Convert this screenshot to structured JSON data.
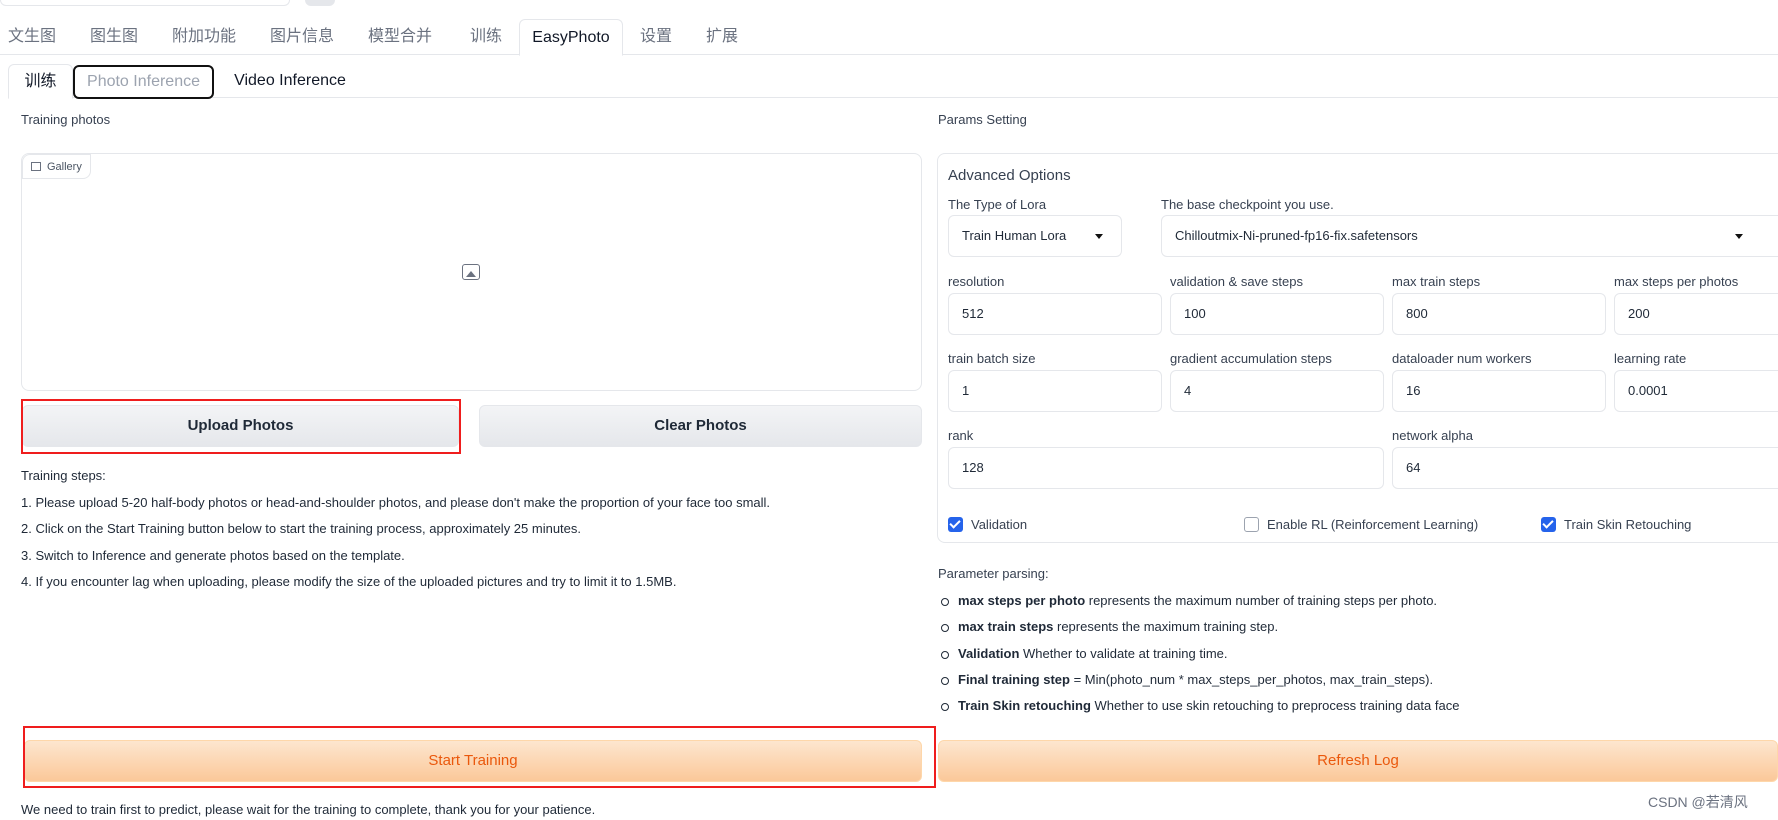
{
  "main_tabs": [
    "文生图",
    "图生图",
    "附加功能",
    "图片信息",
    "模型合并",
    "训练",
    "EasyPhoto",
    "设置",
    "扩展"
  ],
  "sub_tabs": [
    "训练",
    "Photo Inference",
    "Video Inference"
  ],
  "left": {
    "section_label": "Training photos",
    "gallery_label": "Gallery",
    "upload_button": "Upload Photos",
    "clear_button": "Clear Photos",
    "steps_title": "Training steps:",
    "steps": [
      "1. Please upload 5-20 half-body photos or head-and-shoulder photos, and please don't make the proportion of your face too small.",
      "2. Click on the Start Training button below to start the training process, approximately 25 minutes.",
      "3. Switch to Inference and generate photos based on the template.",
      "4. If you encounter lag when uploading, please modify the size of the uploaded pictures and try to limit it to 1.5MB."
    ],
    "start_button": "Start Training",
    "footer_note": "We need to train first to predict, please wait for the training to complete, thank you for your patience."
  },
  "right": {
    "section_label": "Params Setting",
    "advanced_title": "Advanced Options",
    "lora_type_label": "The Type of Lora",
    "lora_type_value": "Train Human Lora",
    "checkpoint_label": "The base checkpoint you use.",
    "checkpoint_value": "Chilloutmix-Ni-pruned-fp16-fix.safetensors",
    "fields": {
      "resolution": {
        "label": "resolution",
        "value": "512"
      },
      "val_steps": {
        "label": "validation & save steps",
        "value": "100"
      },
      "max_train_steps": {
        "label": "max train steps",
        "value": "800"
      },
      "max_steps_per_photos": {
        "label": "max steps per photos",
        "value": "200"
      },
      "batch_size": {
        "label": "train batch size",
        "value": "1"
      },
      "grad_accum": {
        "label": "gradient accumulation steps",
        "value": "4"
      },
      "workers": {
        "label": "dataloader num workers",
        "value": "16"
      },
      "lr": {
        "label": "learning rate",
        "value": "0.0001"
      },
      "rank": {
        "label": "rank",
        "value": "128"
      },
      "alpha": {
        "label": "network alpha",
        "value": "64"
      }
    },
    "checkboxes": {
      "validation": {
        "label": "Validation",
        "checked": true
      },
      "rl": {
        "label": "Enable RL (Reinforcement Learning)",
        "checked": false
      },
      "skin": {
        "label": "Train Skin Retouching",
        "checked": true
      }
    },
    "parsing_title": "Parameter parsing:",
    "parsing": [
      {
        "key": "max steps per photo",
        "text": " represents the maximum number of training steps per photo."
      },
      {
        "key": "max train steps",
        "text": " represents the maximum training step."
      },
      {
        "key": "Validation",
        "text": " Whether to validate at training time."
      },
      {
        "key": "Final training step",
        "text": " = Min(photo_num * max_steps_per_photos, max_train_steps)."
      },
      {
        "key": "Train Skin retouching",
        "text": " Whether to use skin retouching to preprocess training data face"
      }
    ],
    "refresh_button": "Refresh Log"
  },
  "watermark": "CSDN @若清风"
}
